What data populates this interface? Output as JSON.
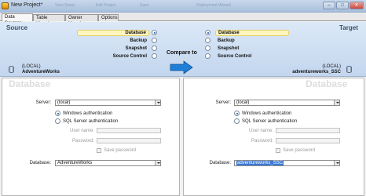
{
  "window": {
    "title": "New Project*",
    "faded_toolbar": [
      "View Setup",
      "Edit Project",
      "Save",
      "Deployment Wizard"
    ],
    "controls": [
      "–",
      "□",
      "✕"
    ]
  },
  "tabs": [
    "Data Sources",
    "Table Mapping",
    "Owner Mapping",
    "Options"
  ],
  "header": {
    "source_label": "Source",
    "target_label": "Target",
    "compare_label": "Compare to",
    "source_options": [
      {
        "label": "Database",
        "selected": true
      },
      {
        "label": "Backup",
        "selected": false
      },
      {
        "label": "Snapshot",
        "selected": false
      },
      {
        "label": "Source Control",
        "selected": false
      }
    ],
    "target_options": [
      {
        "label": "Database",
        "selected": true
      },
      {
        "label": "Backup",
        "selected": false
      },
      {
        "label": "Snapshot",
        "selected": false
      },
      {
        "label": "Source Control",
        "selected": false
      }
    ],
    "source_server": "(LOCAL)",
    "source_database": "AdventureWorks",
    "target_server": "(LOCAL)",
    "target_database": "adventureworks_SSC",
    "arrow_color": "#1f7fd8"
  },
  "left_pane": {
    "title": "Database",
    "server_label": "Server:",
    "server_value": "(local)",
    "auth_windows": "Windows authentication",
    "auth_sql": "SQL Server authentication",
    "username_label": "User name:",
    "password_label": "Password:",
    "save_password": "Save password",
    "database_label": "Database:",
    "database_value": "AdventureWorks"
  },
  "right_pane": {
    "title": "Database",
    "server_label": "Server:",
    "server_value": "(local)",
    "auth_windows": "Windows authentication",
    "auth_sql": "SQL Server authentication",
    "username_label": "User name:",
    "password_label": "Password:",
    "save_password": "Save password",
    "database_label": "Database:",
    "database_value": "adventureworks_SSC"
  }
}
